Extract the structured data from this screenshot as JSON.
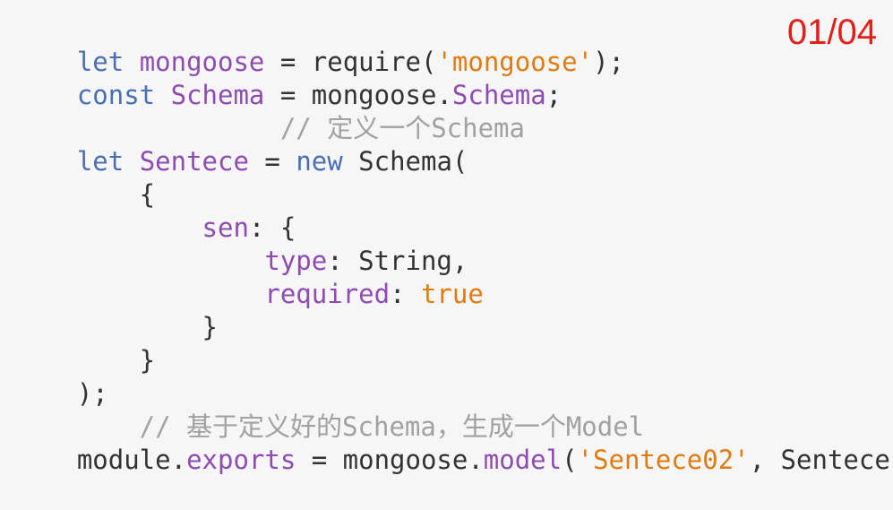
{
  "page_indicator": "01/04",
  "code": {
    "lines": [
      [
        {
          "t": "let",
          "k": "keyword"
        },
        {
          "t": " ",
          "k": "plain"
        },
        {
          "t": "mongoose",
          "k": "var"
        },
        {
          "t": " = require(",
          "k": "plain"
        },
        {
          "t": "'mongoose'",
          "k": "string"
        },
        {
          "t": ");",
          "k": "plain"
        }
      ],
      [
        {
          "t": "const",
          "k": "keyword"
        },
        {
          "t": " ",
          "k": "plain"
        },
        {
          "t": "Schema",
          "k": "var"
        },
        {
          "t": " = mongoose.",
          "k": "plain"
        },
        {
          "t": "Schema",
          "k": "prop"
        },
        {
          "t": ";",
          "k": "plain"
        }
      ],
      [
        {
          "t": "             // 定义一个Schema",
          "k": "comment"
        }
      ],
      [
        {
          "t": "let",
          "k": "keyword"
        },
        {
          "t": " ",
          "k": "plain"
        },
        {
          "t": "Sentece",
          "k": "var"
        },
        {
          "t": " = ",
          "k": "plain"
        },
        {
          "t": "new",
          "k": "keyword"
        },
        {
          "t": " Schema(",
          "k": "plain"
        }
      ],
      [
        {
          "t": "    {",
          "k": "plain"
        }
      ],
      [
        {
          "t": "        ",
          "k": "plain"
        },
        {
          "t": "sen",
          "k": "prop"
        },
        {
          "t": ": {",
          "k": "plain"
        }
      ],
      [
        {
          "t": "            ",
          "k": "plain"
        },
        {
          "t": "type",
          "k": "prop"
        },
        {
          "t": ": String,",
          "k": "plain"
        }
      ],
      [
        {
          "t": "            ",
          "k": "plain"
        },
        {
          "t": "required",
          "k": "prop"
        },
        {
          "t": ": ",
          "k": "plain"
        },
        {
          "t": "true",
          "k": "bool"
        }
      ],
      [
        {
          "t": "        }",
          "k": "plain"
        }
      ],
      [
        {
          "t": "    }",
          "k": "plain"
        }
      ],
      [
        {
          "t": ");",
          "k": "plain"
        }
      ],
      [
        {
          "t": "    // 基于定义好的Schema，生成一个Model",
          "k": "comment"
        }
      ],
      [
        {
          "t": "module.",
          "k": "plain"
        },
        {
          "t": "exports",
          "k": "prop"
        },
        {
          "t": " = mongoose.",
          "k": "plain"
        },
        {
          "t": "model",
          "k": "prop"
        },
        {
          "t": "(",
          "k": "plain"
        },
        {
          "t": "'Sentece02'",
          "k": "string"
        },
        {
          "t": ", Sentece);",
          "k": "plain"
        }
      ]
    ]
  },
  "colors": {
    "background": "#f6f6f6",
    "keyword": "#4a6fb5",
    "identifier": "#8e4cb2",
    "string": "#e07b10",
    "comment": "#a1a1a1",
    "text": "#333333",
    "page_indicator": "#e0201b"
  }
}
